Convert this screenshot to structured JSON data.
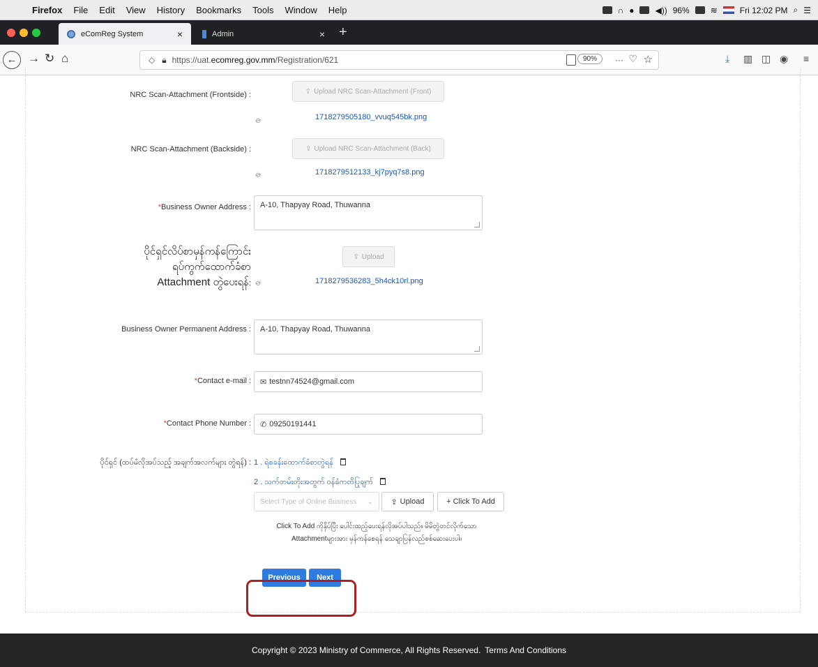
{
  "menubar": {
    "app": "Firefox",
    "items": [
      "File",
      "Edit",
      "View",
      "History",
      "Bookmarks",
      "Tools",
      "Window",
      "Help"
    ],
    "battery": "96%",
    "clock": "Fri 12:02 PM"
  },
  "tabs": [
    {
      "title": "eComReg System",
      "close": "×"
    },
    {
      "title": "Admin",
      "close": "×"
    }
  ],
  "nav": {
    "url_prefix": "https://uat.",
    "url_domain": "ecomreg.gov.mm",
    "url_path": "/Registration/621",
    "zoom": "90%",
    "more": "···"
  },
  "form": {
    "nrc_front": {
      "label": "NRC Scan-Attachment (Frontside) :",
      "button": "Upload NRC Scan-Attachment (Front)",
      "file": "1718279505180_vvuq545bk.png"
    },
    "nrc_back": {
      "label": "NRC Scan-Attachment (Backside) :",
      "button": "Upload NRC Scan-Attachment (Back)",
      "file": "1718279512133_kj7pyq7s8.png"
    },
    "owner_address": {
      "required": "*",
      "label": "Business Owner Address :",
      "value": "A-10, Thapyay Road, Thuwanna"
    },
    "address_proof": {
      "line1": "ပိုင်ရှင်လိပ်စာမှန်ကန်ကြောင်း",
      "line2": "ရပ်ကွက်ထောက်ခံစာ",
      "line3": "Attachment တွဲပေးရန်",
      "colon": ":",
      "button": "Upload",
      "file": "1718279536283_5h4ck10rl.png"
    },
    "permanent_address": {
      "label": "Business Owner Permanent Address :",
      "value": "A-10, Thapyay Road, Thuwanna"
    },
    "email": {
      "required": "*",
      "label": "Contact e-mail :",
      "value": "testnn74524@gmail.com"
    },
    "phone": {
      "required": "*",
      "label": "Contact Phone Number :",
      "value": "09250191441"
    },
    "owner_docs": {
      "label": "ပိုင်ရှင် (ထပ်မံလိုအပ်သည့် အချက်အလက်များ တွဲရန်) :",
      "attachments": [
        "1 . ရဲစခန်းထောက်ခံစာတွဲရန်",
        "2 . သက်တမ်းတိုးအတွက် ဝန်ခံကတိပြုချက်"
      ],
      "select_placeholder": "Select Type of Online Business",
      "upload_button": "Upload",
      "add_button": "+ Click To Add",
      "note_line1": "Click To Add ကိုနှိပ်ပြီး ပေါင်းထည့်ပေးရန်လိုအပ်ပါသည်။ မိမိတွဲတင်လိုက်သော",
      "note_line2": "Attachmentများအား မှန်ကန်စေရန် သေချာပြန်လည်စစ်ဆေးပေးပါ။"
    },
    "buttons": {
      "previous": "Previous",
      "next": "Next"
    }
  },
  "footer": {
    "copyright": "Copyright © 2023 Ministry of Commerce, All Rights Reserved.",
    "terms": "Terms And Conditions"
  },
  "colors": {
    "primary": "#2f7be0",
    "link": "#1a56c4",
    "required": "#e53935",
    "highlight": "#b01e1e",
    "footer": "#252525"
  }
}
